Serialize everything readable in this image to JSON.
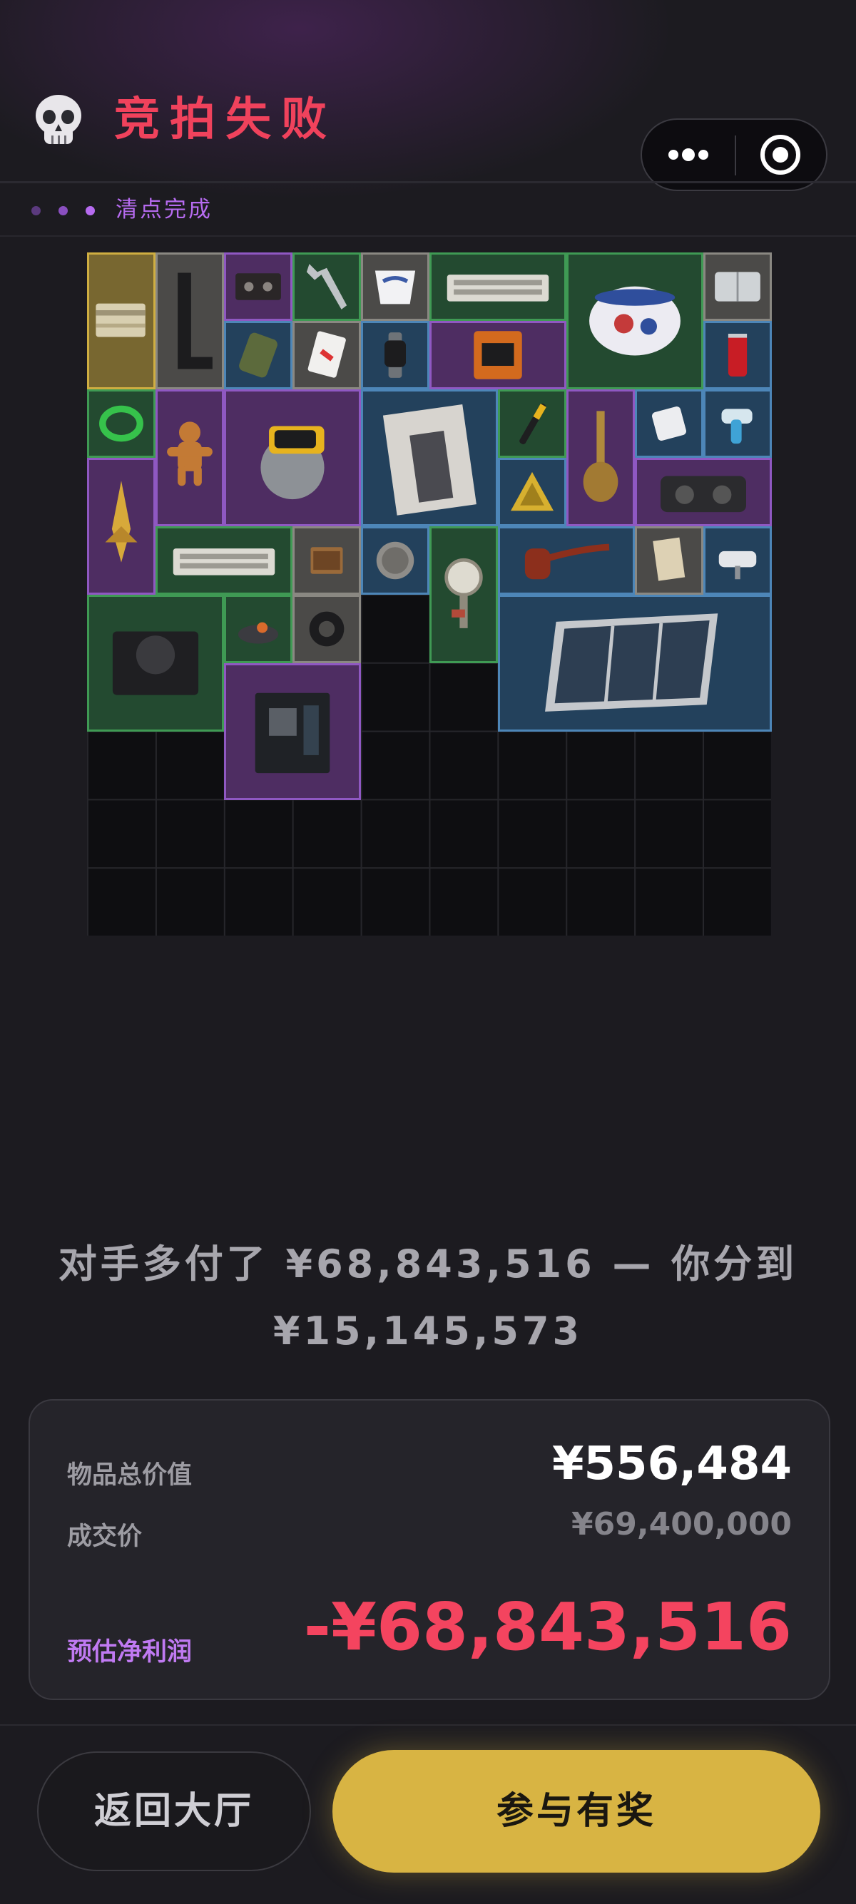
{
  "header": {
    "title": "竞拍失败",
    "status_text": "清点完成",
    "status_dot_colors": [
      "#5b3a7e",
      "#8a4fc0",
      "#b66bf0"
    ]
  },
  "inventory": {
    "grid_columns": 10,
    "grid_rows": 10,
    "rarity_colors": {
      "gold": "#cfae41",
      "gray": "#8a8882",
      "purple": "#8f58c2",
      "green": "#3f9a54",
      "blue": "#4d86b8"
    },
    "items": [
      {
        "name": "cash-bundle-icon",
        "rarity": "gold"
      },
      {
        "name": "l-bracket-icon",
        "rarity": "gray"
      },
      {
        "name": "cassette-tape-icon",
        "rarity": "purple"
      },
      {
        "name": "wrench-icon",
        "rarity": "green"
      },
      {
        "name": "porcelain-cup-icon",
        "rarity": "gray"
      },
      {
        "name": "keyboard-icon",
        "rarity": "green"
      },
      {
        "name": "porcelain-pot-icon",
        "rarity": "green"
      },
      {
        "name": "storage-box-icon",
        "rarity": "gray"
      },
      {
        "name": "ration-pack-icon",
        "rarity": "blue"
      },
      {
        "name": "playing-card-icon",
        "rarity": "gray"
      },
      {
        "name": "smartwatch-icon",
        "rarity": "blue"
      },
      {
        "name": "gpu-box-icon",
        "rarity": "purple"
      },
      {
        "name": "cola-can-icon",
        "rarity": "blue"
      },
      {
        "name": "cable-coil-icon",
        "rarity": "green"
      },
      {
        "name": "gingerbread-man-icon",
        "rarity": "purple"
      },
      {
        "name": "circular-saw-icon",
        "rarity": "purple"
      },
      {
        "name": "fashion-magazine-icon",
        "rarity": "blue"
      },
      {
        "name": "screwdriver-icon",
        "rarity": "green"
      },
      {
        "name": "hookah-icon",
        "rarity": "purple"
      },
      {
        "name": "battery-pack-icon",
        "rarity": "blue"
      },
      {
        "name": "thermometer-icon",
        "rarity": "blue"
      },
      {
        "name": "ornament-spear-icon",
        "rarity": "purple"
      },
      {
        "name": "warning-sign-icon",
        "rarity": "blue"
      },
      {
        "name": "boombox-icon",
        "rarity": "purple"
      },
      {
        "name": "keyboard-icon",
        "rarity": "green"
      },
      {
        "name": "matchbox-icon",
        "rarity": "gray"
      },
      {
        "name": "coin-icon",
        "rarity": "blue"
      },
      {
        "name": "pressure-gauge-icon",
        "rarity": "green"
      },
      {
        "name": "tobacco-pipe-icon",
        "rarity": "blue"
      },
      {
        "name": "document-icon",
        "rarity": "gray"
      },
      {
        "name": "security-camera-icon",
        "rarity": "blue"
      },
      {
        "name": "power-supply-icon",
        "rarity": "green"
      },
      {
        "name": "gadget-icon",
        "rarity": "green"
      },
      {
        "name": "tape-roll-icon",
        "rarity": "gray"
      },
      {
        "name": "solar-panel-icon",
        "rarity": "blue"
      },
      {
        "name": "motherboard-icon",
        "rarity": "purple"
      }
    ]
  },
  "summary": {
    "line1": "对手多付了 ¥68,843,516 — 你分到",
    "line2": "¥15,145,573"
  },
  "result_card": {
    "total_label": "物品总价值",
    "total_value": "¥556,484",
    "price_label": "成交价",
    "price_value": "¥69,400,000",
    "profit_label": "预估净利润",
    "profit_value": "-¥68,843,516"
  },
  "buttons": {
    "back_label": "返回大厅",
    "join_label": "参与有奖"
  }
}
